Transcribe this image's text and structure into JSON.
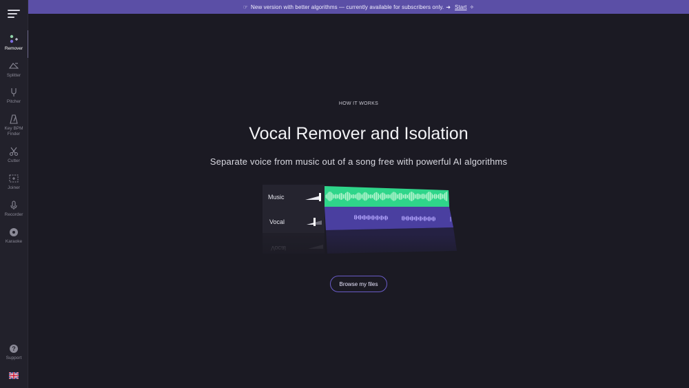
{
  "banner": {
    "icon": "hand-pointing-icon",
    "text": "New version with better algorithms — currently available for subscribers only.",
    "arrow": "➜",
    "link_label": "Start",
    "trailing_icon": "sparkle-icon"
  },
  "sidebar": {
    "items": [
      {
        "label": "Remover",
        "icon": "remover-icon",
        "active": true
      },
      {
        "label": "Splitter",
        "icon": "splitter-icon"
      },
      {
        "label": "Pitcher",
        "icon": "tuning-fork-icon"
      },
      {
        "label": "Key BPM Finder",
        "icon": "metronome-icon"
      },
      {
        "label": "Cutter",
        "icon": "scissors-icon"
      },
      {
        "label": "Joiner",
        "icon": "joiner-icon"
      },
      {
        "label": "Recorder",
        "icon": "microphone-icon"
      },
      {
        "label": "Karaoke",
        "icon": "karaoke-icon"
      }
    ],
    "support_label": "Support",
    "language_icon": "uk-flag-icon"
  },
  "hero": {
    "eyebrow": "HOW IT WORKS",
    "title": "Vocal Remover and Isolation",
    "subtitle": "Separate voice from music out of a song free with powerful AI algorithms",
    "browse_label": "Browse my files"
  },
  "demo": {
    "tracks": [
      {
        "label": "Music",
        "volume": 1.0,
        "color": "#2fd58a"
      },
      {
        "label": "Vocal",
        "volume": 0.55,
        "color": "#7c6de0"
      }
    ]
  },
  "colors": {
    "accent": "#5b4fa6",
    "music_track": "#2fd58a",
    "vocal_track": "#7c6de0",
    "background": "#1b1a23"
  }
}
